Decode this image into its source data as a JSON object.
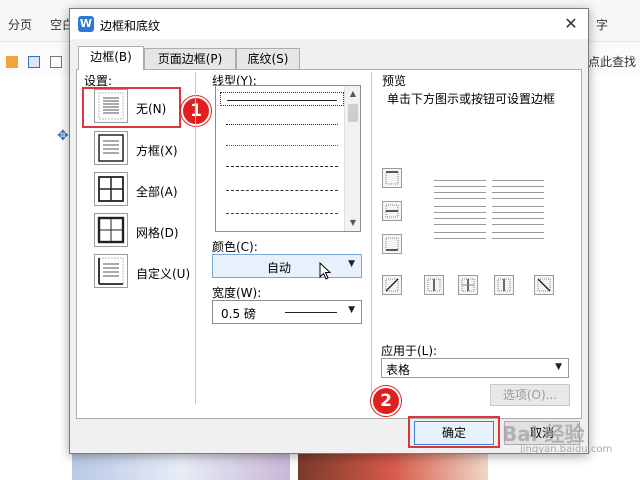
{
  "background": {
    "toolbar_items": [
      "分页",
      "空白"
    ],
    "right_text": "点此查找",
    "right_cut": "字"
  },
  "dialog": {
    "title": "边框和底纹",
    "app_icon_letter": "W",
    "tabs": [
      {
        "label": "边框(B)",
        "active": true
      },
      {
        "label": "页面边框(P)",
        "active": false
      },
      {
        "label": "底纹(S)",
        "active": false
      }
    ],
    "settings": {
      "heading": "设置:",
      "items": [
        {
          "label": "无(N)",
          "icon": "border-none-icon",
          "selected": true
        },
        {
          "label": "方框(X)",
          "icon": "border-box-icon",
          "selected": false
        },
        {
          "label": "全部(A)",
          "icon": "border-all-icon",
          "selected": false
        },
        {
          "label": "网格(D)",
          "icon": "border-grid-icon",
          "selected": false
        },
        {
          "label": "自定义(U)",
          "icon": "border-custom-icon",
          "selected": false
        }
      ]
    },
    "line_style": {
      "heading": "线型(Y):",
      "options": [
        "solid",
        "dotted",
        "dotted-fine",
        "dashed",
        "dash-dot",
        "dash-dot-dot",
        "long-dash"
      ]
    },
    "color": {
      "heading": "颜色(C):",
      "value": "自动"
    },
    "width": {
      "heading": "宽度(W):",
      "value": "0.5  磅"
    },
    "preview": {
      "heading": "预览",
      "hint": "单击下方图示或按钮可设置边框"
    },
    "apply_to": {
      "heading": "应用于(L):",
      "value": "表格"
    },
    "options_button": "选项(O)...",
    "ok_button": "确定",
    "cancel_button": "取消"
  },
  "annotations": {
    "badge1": "1",
    "badge2": "2"
  },
  "watermark": {
    "main": "Bai 经验",
    "sub": "jingyan.baidu.com"
  },
  "colors": {
    "accent": "#2e78d6",
    "highlight": "#d9363e",
    "badge": "#e02020"
  }
}
